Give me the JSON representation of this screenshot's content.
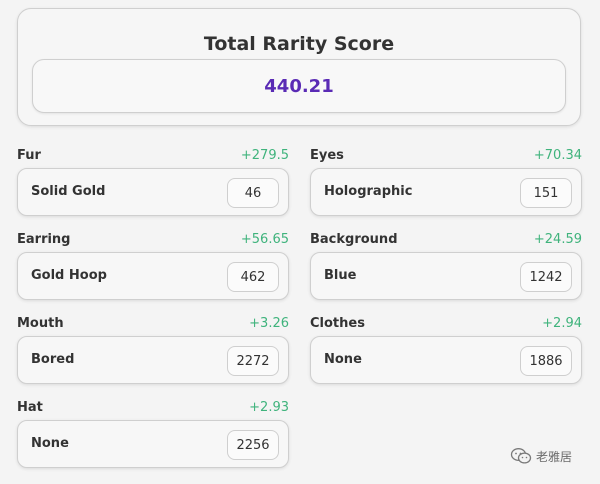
{
  "summary": {
    "title": "Total Rarity Score",
    "value": "440.21"
  },
  "traits": [
    {
      "name": "Fur",
      "score": "+279.5",
      "value": "Solid Gold",
      "count": "46"
    },
    {
      "name": "Eyes",
      "score": "+70.34",
      "value": "Holographic",
      "count": "151"
    },
    {
      "name": "Earring",
      "score": "+56.65",
      "value": "Gold Hoop",
      "count": "462"
    },
    {
      "name": "Background",
      "score": "+24.59",
      "value": "Blue",
      "count": "1242"
    },
    {
      "name": "Mouth",
      "score": "+3.26",
      "value": "Bored",
      "count": "2272"
    },
    {
      "name": "Clothes",
      "score": "+2.94",
      "value": "None",
      "count": "1886"
    },
    {
      "name": "Hat",
      "score": "+2.93",
      "value": "None",
      "count": "2256"
    }
  ],
  "watermark": {
    "text": "老雅居",
    "icon": "wechat-icon"
  },
  "colors": {
    "score": "#5a2bb5",
    "positive": "#3fb37c",
    "text": "#333333",
    "background": "#f4f4f4"
  }
}
